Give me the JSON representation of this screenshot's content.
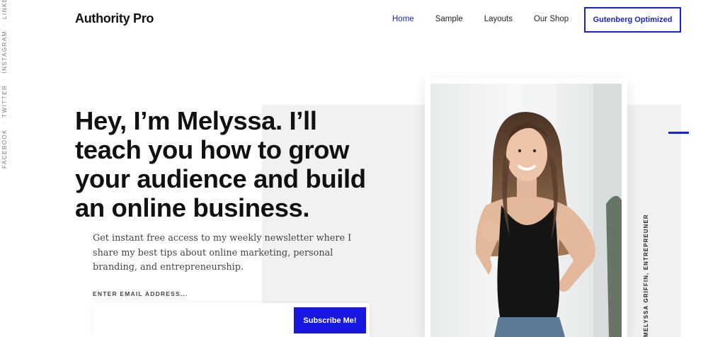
{
  "social": {
    "items": [
      "FACEBOOK",
      "TWITTER",
      "INSTAGRAM",
      "LINKEDIN"
    ],
    "separator": "·"
  },
  "header": {
    "logo": "Authority Pro",
    "nav": [
      "Home",
      "Sample",
      "Layouts",
      "Our Shop"
    ],
    "active_index": 0,
    "cta": "Gutenberg Optimized"
  },
  "hero": {
    "headline": "Hey, I’m Melyssa. I’ll teach you how to grow your audience and build an online business.",
    "intro": "Get instant free access to my weekly newsletter where I share my best tips about online marketing, personal branding, and entrepreneurship.",
    "email_label": "ENTER EMAIL ADDRESS...",
    "email_value": "",
    "subscribe": "Subscribe Me!",
    "caption": "MELYSSA GRIFFIN, ENTREPREUNER"
  },
  "colors": {
    "accent": "#1a22d6",
    "button": "#1717e0",
    "band": "#f1f1f1"
  }
}
